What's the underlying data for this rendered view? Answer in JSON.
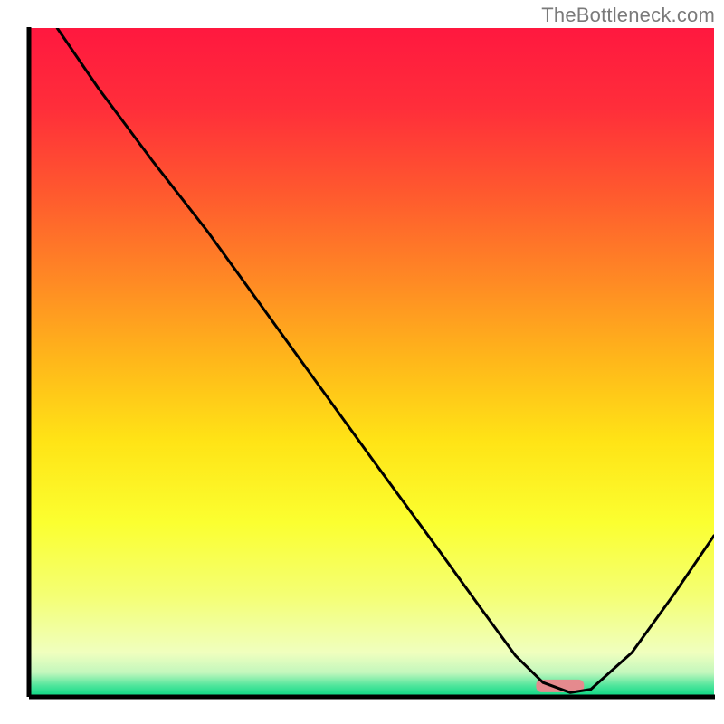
{
  "watermark": "TheBottleneck.com",
  "chart_data": {
    "type": "line",
    "title": "",
    "xlabel": "",
    "ylabel": "",
    "xlim": [
      0,
      100
    ],
    "ylim": [
      0,
      100
    ],
    "annotations": [],
    "series": [
      {
        "name": "curve",
        "x": [
          4,
          10,
          18,
          26,
          38,
          50,
          60,
          66,
          71,
          75,
          79,
          82,
          88,
          94,
          100
        ],
        "values": [
          100,
          91,
          80,
          69.5,
          52.5,
          35.5,
          21.5,
          13,
          6,
          2,
          0.5,
          1,
          6.5,
          15,
          24
        ]
      }
    ],
    "marker": {
      "name": "highlight-range",
      "x_start": 74,
      "x_end": 81,
      "y": 1.5,
      "color": "#e58a8e"
    },
    "gradient_stops": [
      {
        "offset": 0.0,
        "color": "#ff183f"
      },
      {
        "offset": 0.12,
        "color": "#ff2e3a"
      },
      {
        "offset": 0.25,
        "color": "#ff5a2e"
      },
      {
        "offset": 0.38,
        "color": "#ff8a24"
      },
      {
        "offset": 0.5,
        "color": "#ffb81a"
      },
      {
        "offset": 0.62,
        "color": "#ffe416"
      },
      {
        "offset": 0.74,
        "color": "#fbff30"
      },
      {
        "offset": 0.85,
        "color": "#f4ff74"
      },
      {
        "offset": 0.935,
        "color": "#f0ffbe"
      },
      {
        "offset": 0.965,
        "color": "#c3f7bd"
      },
      {
        "offset": 0.985,
        "color": "#4de59b"
      },
      {
        "offset": 1.0,
        "color": "#0bd884"
      }
    ],
    "axes": {
      "left": {
        "x": 32,
        "y0": 30,
        "y1": 770
      },
      "bottom": {
        "y": 770,
        "x0": 32,
        "x1": 790
      },
      "inner": {
        "x0": 33,
        "y0": 31,
        "x1": 789,
        "y1": 769
      }
    }
  }
}
